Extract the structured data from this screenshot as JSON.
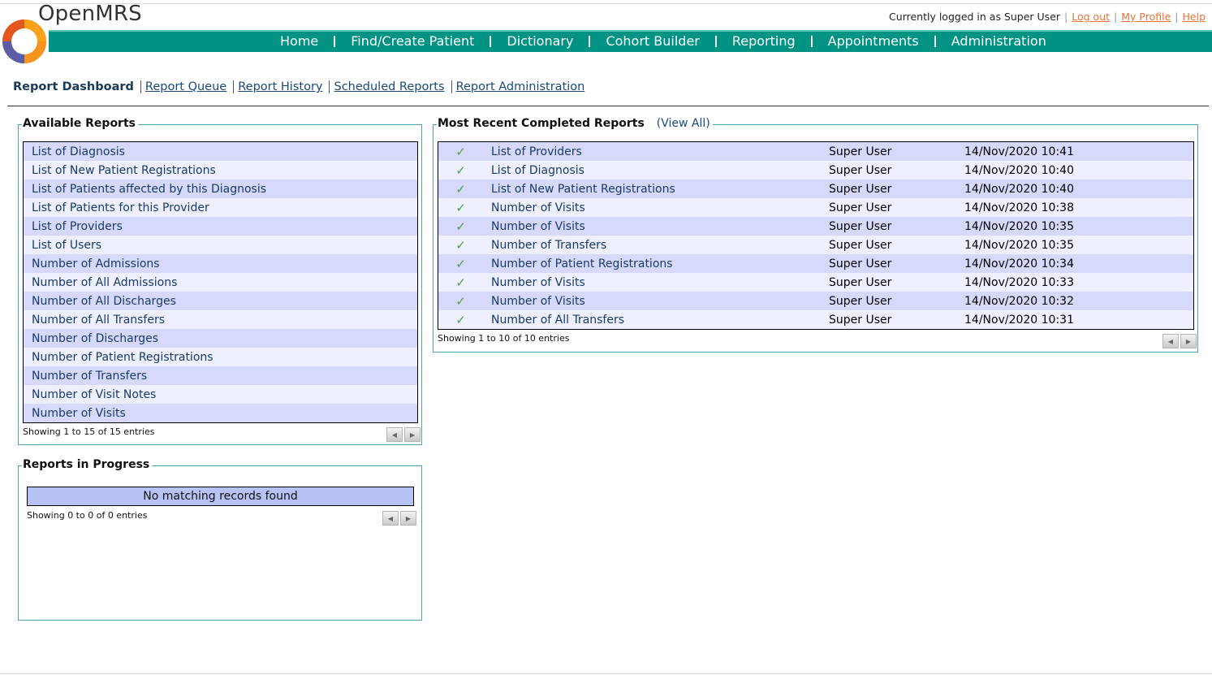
{
  "app": {
    "logo_text": "OpenMRS"
  },
  "colors": {
    "nav_bg": "#009384",
    "row_odd": "#d6d9fb",
    "row_even": "#eef0ff",
    "link": "#1a4a7a",
    "accent_link": "#e8723a",
    "check": "#5b9a4a",
    "fieldset_border": "#4ba5b4"
  },
  "userbar": {
    "logged_in_text": "Currently logged in as Super User",
    "logout": "Log out",
    "profile": "My Profile",
    "help": "Help"
  },
  "nav": {
    "items": [
      "Home",
      "Find/Create Patient",
      "Dictionary",
      "Cohort Builder",
      "Reporting",
      "Appointments",
      "Administration"
    ]
  },
  "subnav": {
    "current": "Report Dashboard",
    "links": [
      "Report Queue",
      "Report History",
      "Scheduled Reports",
      "Report Administration"
    ]
  },
  "available_reports": {
    "title": "Available Reports",
    "rows": [
      "List of Diagnosis",
      "List of New Patient Registrations",
      "List of Patients affected by this Diagnosis",
      "List of Patients for this Provider",
      "List of Providers",
      "List of Users",
      "Number of Admissions",
      "Number of All Admissions",
      "Number of All Discharges",
      "Number of All Transfers",
      "Number of Discharges",
      "Number of Patient Registrations",
      "Number of Transfers",
      "Number of Visit Notes",
      "Number of Visits"
    ],
    "info": "Showing 1 to 15 of 15 entries"
  },
  "in_progress": {
    "title": "Reports in Progress",
    "empty_text": "No matching records found",
    "info": "Showing 0 to 0 of 0 entries"
  },
  "completed": {
    "title": "Most Recent Completed Reports",
    "view_all": "(View All)",
    "check_icon": "check-icon",
    "rows": [
      {
        "report": "List of Providers",
        "user": "Super User",
        "date": "14/Nov/2020 10:41"
      },
      {
        "report": "List of Diagnosis",
        "user": "Super User",
        "date": "14/Nov/2020 10:40"
      },
      {
        "report": "List of New Patient Registrations",
        "user": "Super User",
        "date": "14/Nov/2020 10:40"
      },
      {
        "report": "Number of Visits",
        "user": "Super User",
        "date": "14/Nov/2020 10:38"
      },
      {
        "report": "Number of Visits",
        "user": "Super User",
        "date": "14/Nov/2020 10:35"
      },
      {
        "report": "Number of Transfers",
        "user": "Super User",
        "date": "14/Nov/2020 10:35"
      },
      {
        "report": "Number of Patient Registrations",
        "user": "Super User",
        "date": "14/Nov/2020 10:34"
      },
      {
        "report": "Number of Visits",
        "user": "Super User",
        "date": "14/Nov/2020 10:33"
      },
      {
        "report": "Number of Visits",
        "user": "Super User",
        "date": "14/Nov/2020 10:32"
      },
      {
        "report": "Number of All Transfers",
        "user": "Super User",
        "date": "14/Nov/2020 10:31"
      }
    ],
    "info": "Showing 1 to 10 of 10 entries"
  }
}
